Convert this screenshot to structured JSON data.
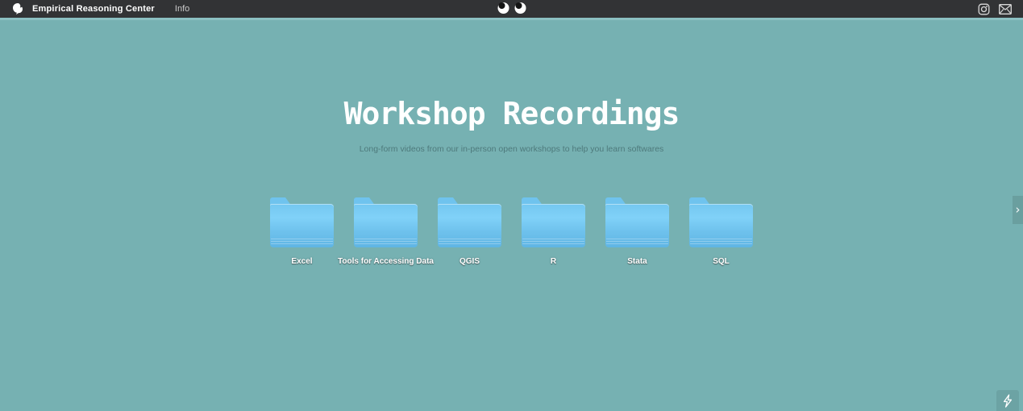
{
  "navbar": {
    "brand": "Empirical Reasoning Center",
    "info_label": "Info",
    "icons": {
      "logo": "erc-logo-icon",
      "center": "eyes-icon",
      "right": [
        "instagram-icon",
        "email-icon"
      ]
    },
    "bg_color": "#323335"
  },
  "hero": {
    "title": "Workshop Recordings",
    "subtitle": "Long-form videos from our in-person open workshops to help you learn softwares"
  },
  "folders": [
    {
      "label": "Excel"
    },
    {
      "label": "Tools for Accessing Data"
    },
    {
      "label": "QGIS"
    },
    {
      "label": "R"
    },
    {
      "label": "Stata"
    },
    {
      "label": "SQL"
    }
  ],
  "carousel": {
    "next_glyph": "›"
  },
  "badges": {
    "bolt": "lightning-bolt-icon"
  },
  "colors": {
    "page_bg": "#76b1b2",
    "navbar_bg": "#323335",
    "folder_blue_top": "#80d1f8",
    "folder_blue_bottom": "#5fb5e4",
    "title_text": "#ffffff",
    "subtitle_text": "#4e7a7c"
  }
}
